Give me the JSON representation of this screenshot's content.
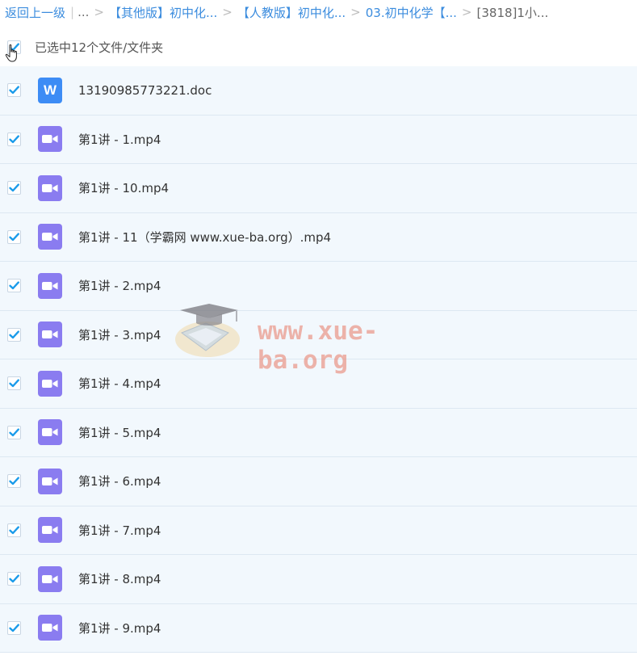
{
  "breadcrumb": {
    "back": "返回上一级",
    "separator_bar": "|",
    "ellipsis": "...",
    "sep": ">",
    "items": [
      {
        "label": "【其他版】初中化..."
      },
      {
        "label": "【人教版】初中化..."
      },
      {
        "label": "03.初中化学【..."
      }
    ],
    "current": "[3818]1小..."
  },
  "selection": {
    "text": "已选中12个文件/文件夹",
    "checked": true
  },
  "files": [
    {
      "name": "13190985773221.doc",
      "type": "doc",
      "icon_letter": "W",
      "checked": true
    },
    {
      "name": "第1讲 - 1.mp4",
      "type": "video",
      "checked": true
    },
    {
      "name": "第1讲 - 10.mp4",
      "type": "video",
      "checked": true
    },
    {
      "name": "第1讲 - 11（学霸网 www.xue-ba.org）.mp4",
      "type": "video",
      "checked": true
    },
    {
      "name": "第1讲 - 2.mp4",
      "type": "video",
      "checked": true
    },
    {
      "name": "第1讲 - 3.mp4",
      "type": "video",
      "checked": true
    },
    {
      "name": "第1讲 - 4.mp4",
      "type": "video",
      "checked": true
    },
    {
      "name": "第1讲 - 5.mp4",
      "type": "video",
      "checked": true
    },
    {
      "name": "第1讲 - 6.mp4",
      "type": "video",
      "checked": true
    },
    {
      "name": "第1讲 - 7.mp4",
      "type": "video",
      "checked": true
    },
    {
      "name": "第1讲 - 8.mp4",
      "type": "video",
      "checked": true
    },
    {
      "name": "第1讲 - 9.mp4",
      "type": "video",
      "checked": true
    }
  ],
  "watermark": {
    "text": "www.xue-ba.org"
  },
  "colors": {
    "link": "#3b8cde",
    "check": "#1a9bea",
    "row_bg": "#f2f8fd",
    "doc_icon": "#3d8cf5",
    "video_icon": "#8a7cf0"
  }
}
